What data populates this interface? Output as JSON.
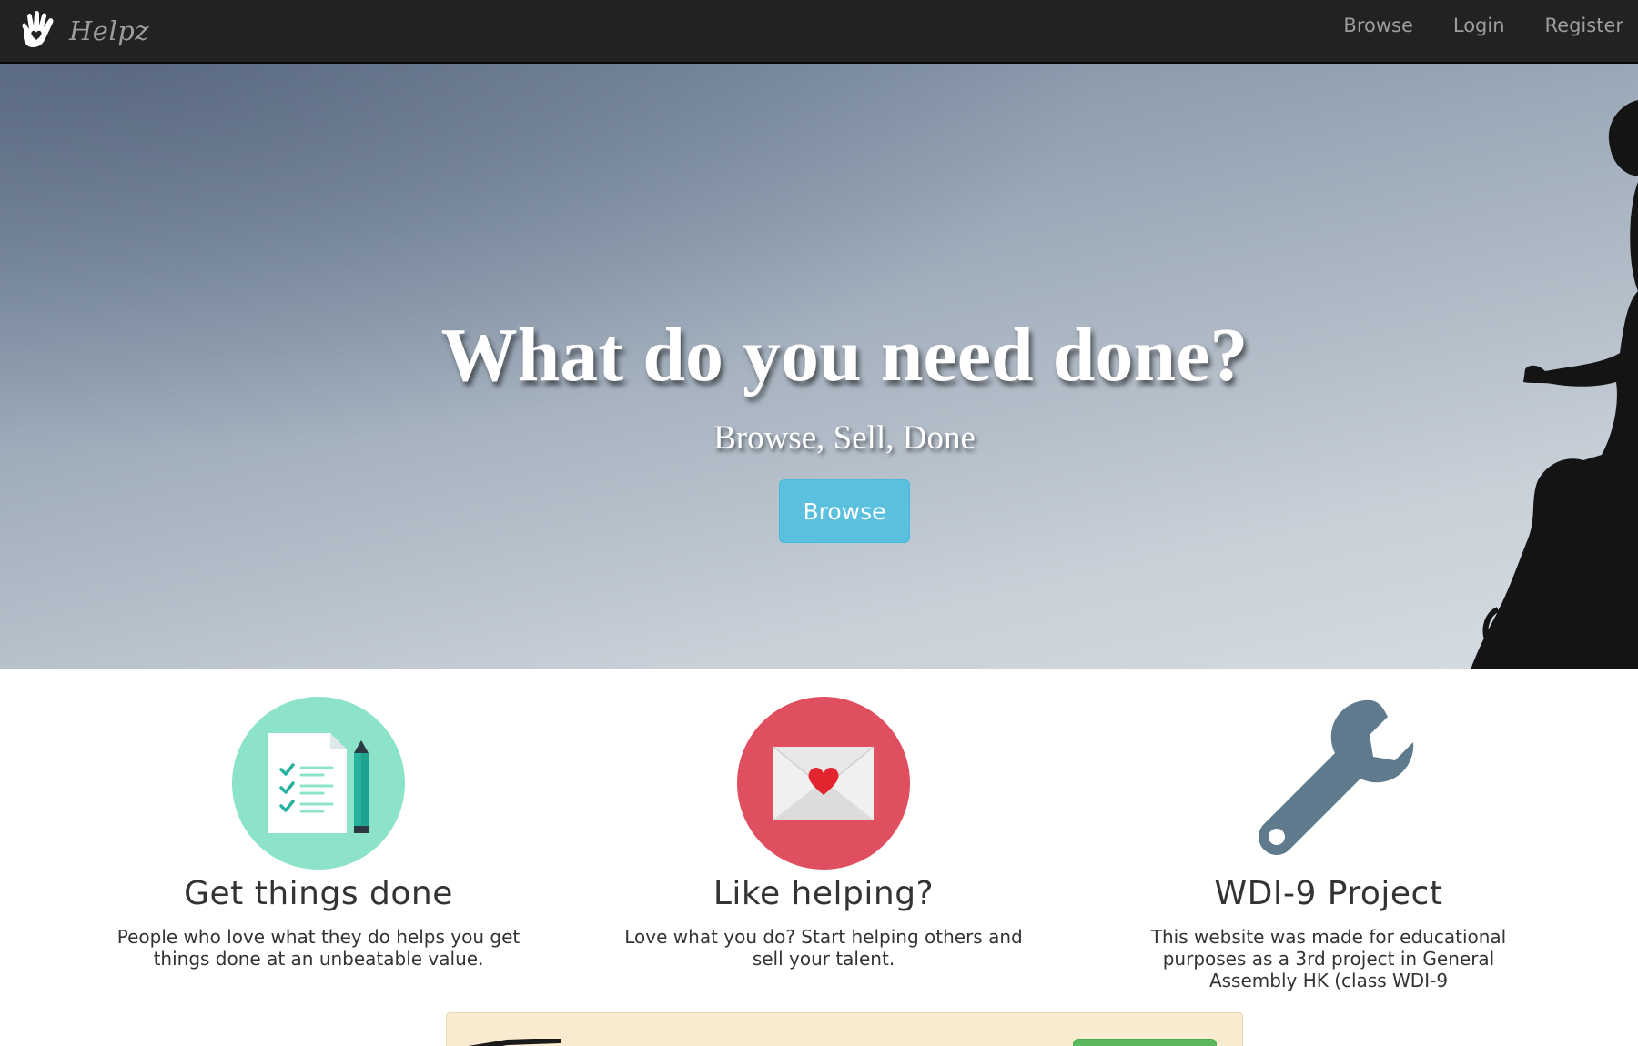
{
  "navbar": {
    "brand_name": "Helpz",
    "logo_icon": "hand-heart-icon",
    "links": [
      {
        "label": "Browse"
      },
      {
        "label": "Login"
      },
      {
        "label": "Register"
      }
    ]
  },
  "hero": {
    "title": "What do you need done?",
    "subtitle": "Browse, Sell, Done",
    "button_label": "Browse"
  },
  "features": [
    {
      "icon": "checklist-pencil-icon",
      "title": "Get things done",
      "text": "People who love what they do helps you get things done at an unbeatable value."
    },
    {
      "icon": "envelope-heart-icon",
      "title": "Like helping?",
      "text": "Love what you do? Start helping others and sell your talent."
    },
    {
      "icon": "wrench-icon",
      "title": "WDI-9 Project",
      "text": "This website was made for educational purposes as a 3rd project in General Assembly HK (class WDI-9"
    }
  ],
  "colors": {
    "navbar_bg": "#222222",
    "nav_text": "#9d9d9d",
    "hero_button": "#5bc0de",
    "checklist_circle": "#8ce3c9",
    "envelope_circle": "#e04f5f",
    "wrench": "#5f7a8c",
    "panel_bg": "#f9ebcf",
    "panel_button": "#5cb85c"
  }
}
